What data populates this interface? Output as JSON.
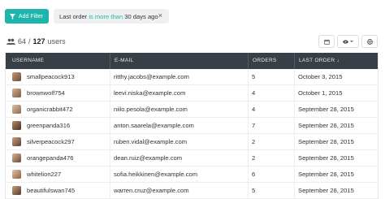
{
  "toolbar": {
    "add_filter_label": "Add Filter",
    "filter": {
      "prefix": "Last order",
      "operator": "is more than",
      "suffix": "30 days ago",
      "close": "×"
    },
    "accent": "#1fb5ac"
  },
  "summary": {
    "shown": "64",
    "separator": "/",
    "total": "127",
    "unit": "users"
  },
  "table": {
    "columns": [
      "USERNAME",
      "E-MAIL",
      "ORDERS",
      "LAST ORDER ↓"
    ],
    "rows": [
      {
        "username": "smallpeacock913",
        "email": "ritthy.jacobs@example.com",
        "orders": "5",
        "last_order": "October 3, 2015"
      },
      {
        "username": "brownwolf754",
        "email": "leevi.niska@example.com",
        "orders": "4",
        "last_order": "October 1, 2015"
      },
      {
        "username": "organicrabbit472",
        "email": "niilo.pesola@example.com",
        "orders": "4",
        "last_order": "September 28, 2015"
      },
      {
        "username": "greenpanda316",
        "email": "anton.saarela@example.com",
        "orders": "7",
        "last_order": "September 28, 2015"
      },
      {
        "username": "silverpeacock297",
        "email": "ruben.vidal@example.com",
        "orders": "2",
        "last_order": "September 28, 2015"
      },
      {
        "username": "orangepanda476",
        "email": "dean.ruiz@example.com",
        "orders": "2",
        "last_order": "September 28, 2015"
      },
      {
        "username": "whitelion227",
        "email": "sofia.heikkinen@example.com",
        "orders": "6",
        "last_order": "September 28, 2015"
      },
      {
        "username": "beautifulswan745",
        "email": "warren.cruz@example.com",
        "orders": "5",
        "last_order": "September 28, 2015"
      }
    ]
  }
}
